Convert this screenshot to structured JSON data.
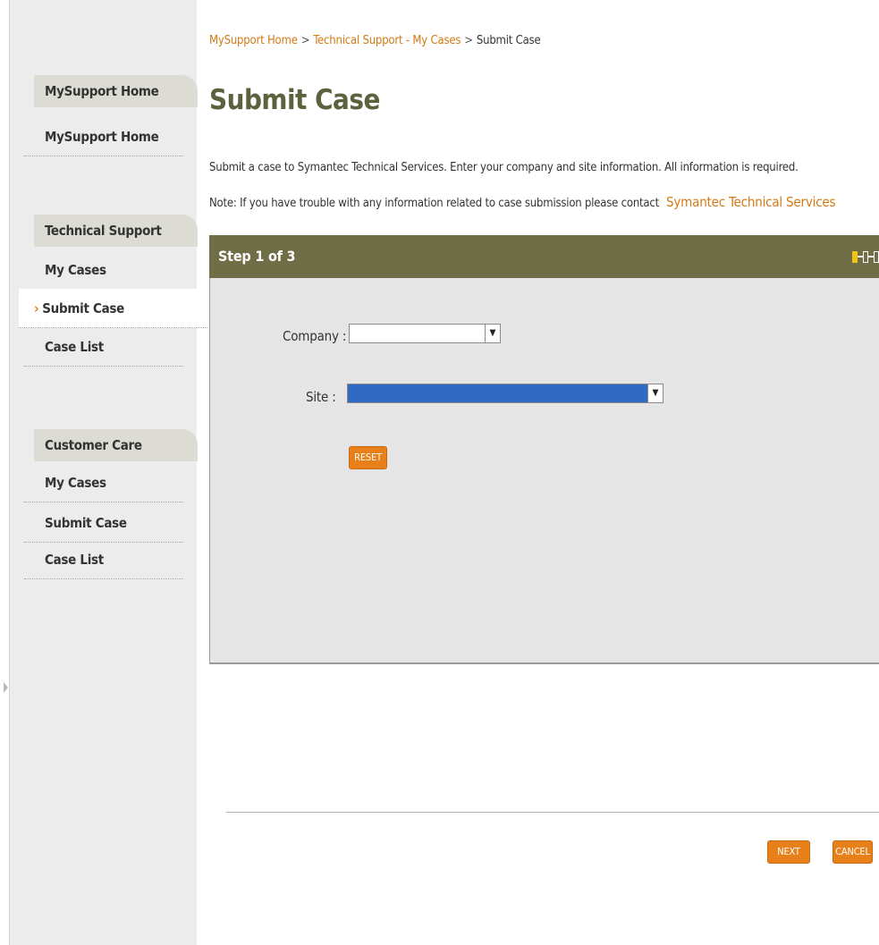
{
  "breadcrumb": {
    "items": [
      "MySupport Home",
      "Technical Support - My Cases",
      "Submit Case"
    ],
    "separator": ">"
  },
  "page": {
    "title": "Submit Case",
    "intro": "Submit a case to Symantec Technical Services. Enter your company and site information. All information is required.",
    "note_prefix": "Note: If you have trouble with any information related to case submission please contact",
    "note_link": "Symantec Technical Services"
  },
  "sidebar": {
    "sections": [
      {
        "title": "MySupport Home",
        "items": [
          "MySupport Home"
        ]
      },
      {
        "title": "Technical Support",
        "items": [
          "My Cases",
          "Submit Case",
          "Case List"
        ],
        "active_index": 1
      },
      {
        "title": "Customer Care",
        "items": [
          "My Cases",
          "Submit Case",
          "Case List"
        ]
      }
    ]
  },
  "wizard": {
    "step_label": "Step 1 of 3",
    "steps_total": 3,
    "current_step": 1,
    "company_label": "Company :",
    "company_value": "",
    "site_label": "Site :",
    "site_value": "",
    "reset_label": "RESET",
    "next_label": "NEXT",
    "cancel_label": "CANCEL"
  },
  "colors": {
    "accent_orange": "#e8801a",
    "link_orange": "#d27914",
    "title_olive": "#5d623e",
    "step_bar": "#6f6e46",
    "progress_active": "#f1c40f",
    "site_select_highlight": "#316ac5"
  },
  "icons": {
    "dropdown": "chevron-down-icon",
    "nav_arrow": "chevron-right-icon",
    "progress": "step-progress-icon"
  }
}
